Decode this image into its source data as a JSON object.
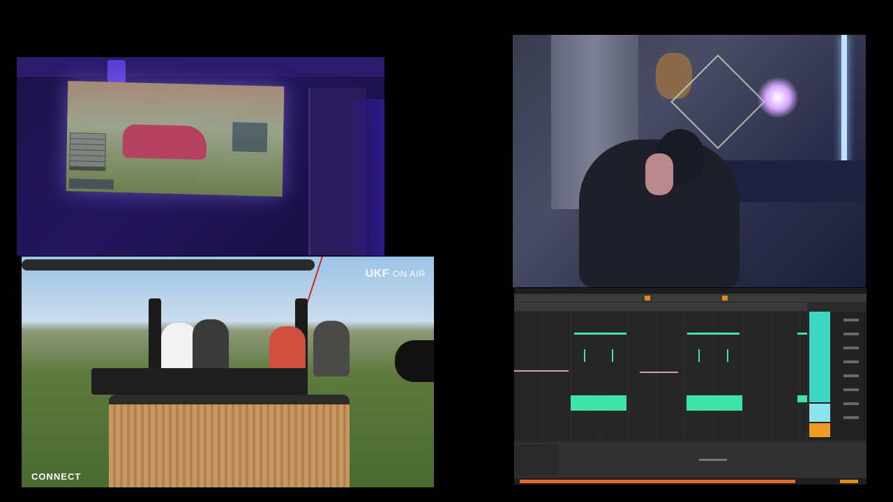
{
  "stream": {
    "panels": {
      "projector_room": {
        "game_menu_items": [
          "ITEM SHOP",
          "ROCKET PASS",
          "GARAGE",
          "CREATE A CLUB",
          "PROFILE",
          "SETTINGS"
        ],
        "player_name": "DANKSTREAM"
      },
      "balloon_dj": {
        "logo_main": "UKF",
        "logo_sub": "ON AIR",
        "caption": "CONNECT"
      },
      "webcam": {},
      "daw": {
        "accent_color": "#3ee4a8",
        "mixer_color": "#3ed8c4",
        "transport_color": "#e08a1a"
      }
    }
  }
}
